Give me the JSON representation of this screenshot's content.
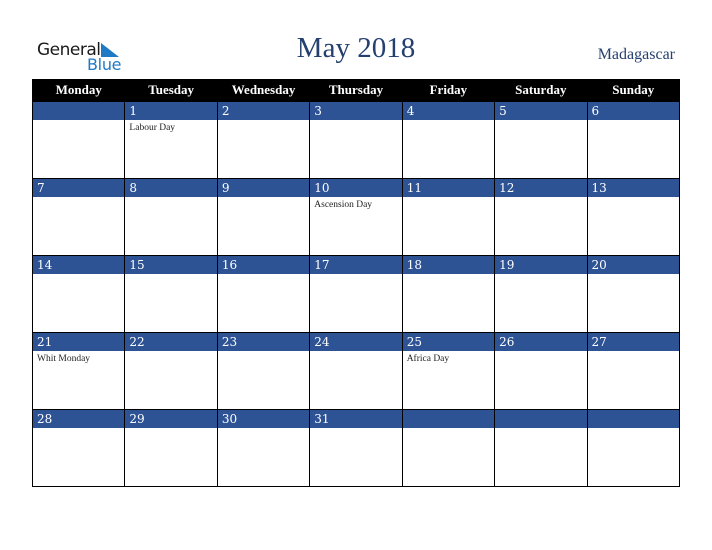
{
  "logo": {
    "line1": "General",
    "line2": "Blue"
  },
  "title": "May 2018",
  "country": "Madagascar",
  "colors": {
    "header_bg": "#000000",
    "day_bar": "#2d5394",
    "title": "#25406f",
    "logo_blue": "#1f7ac6"
  },
  "weekdays": [
    "Monday",
    "Tuesday",
    "Wednesday",
    "Thursday",
    "Friday",
    "Saturday",
    "Sunday"
  ],
  "weeks": [
    [
      {
        "day": "",
        "event": ""
      },
      {
        "day": "1",
        "event": "Labour Day"
      },
      {
        "day": "2",
        "event": ""
      },
      {
        "day": "3",
        "event": ""
      },
      {
        "day": "4",
        "event": ""
      },
      {
        "day": "5",
        "event": ""
      },
      {
        "day": "6",
        "event": ""
      }
    ],
    [
      {
        "day": "7",
        "event": ""
      },
      {
        "day": "8",
        "event": ""
      },
      {
        "day": "9",
        "event": ""
      },
      {
        "day": "10",
        "event": "Ascension Day"
      },
      {
        "day": "11",
        "event": ""
      },
      {
        "day": "12",
        "event": ""
      },
      {
        "day": "13",
        "event": ""
      }
    ],
    [
      {
        "day": "14",
        "event": ""
      },
      {
        "day": "15",
        "event": ""
      },
      {
        "day": "16",
        "event": ""
      },
      {
        "day": "17",
        "event": ""
      },
      {
        "day": "18",
        "event": ""
      },
      {
        "day": "19",
        "event": ""
      },
      {
        "day": "20",
        "event": ""
      }
    ],
    [
      {
        "day": "21",
        "event": "Whit Monday"
      },
      {
        "day": "22",
        "event": ""
      },
      {
        "day": "23",
        "event": ""
      },
      {
        "day": "24",
        "event": ""
      },
      {
        "day": "25",
        "event": "Africa Day"
      },
      {
        "day": "26",
        "event": ""
      },
      {
        "day": "27",
        "event": ""
      }
    ],
    [
      {
        "day": "28",
        "event": ""
      },
      {
        "day": "29",
        "event": ""
      },
      {
        "day": "30",
        "event": ""
      },
      {
        "day": "31",
        "event": ""
      },
      {
        "day": "",
        "event": ""
      },
      {
        "day": "",
        "event": ""
      },
      {
        "day": "",
        "event": ""
      }
    ]
  ]
}
